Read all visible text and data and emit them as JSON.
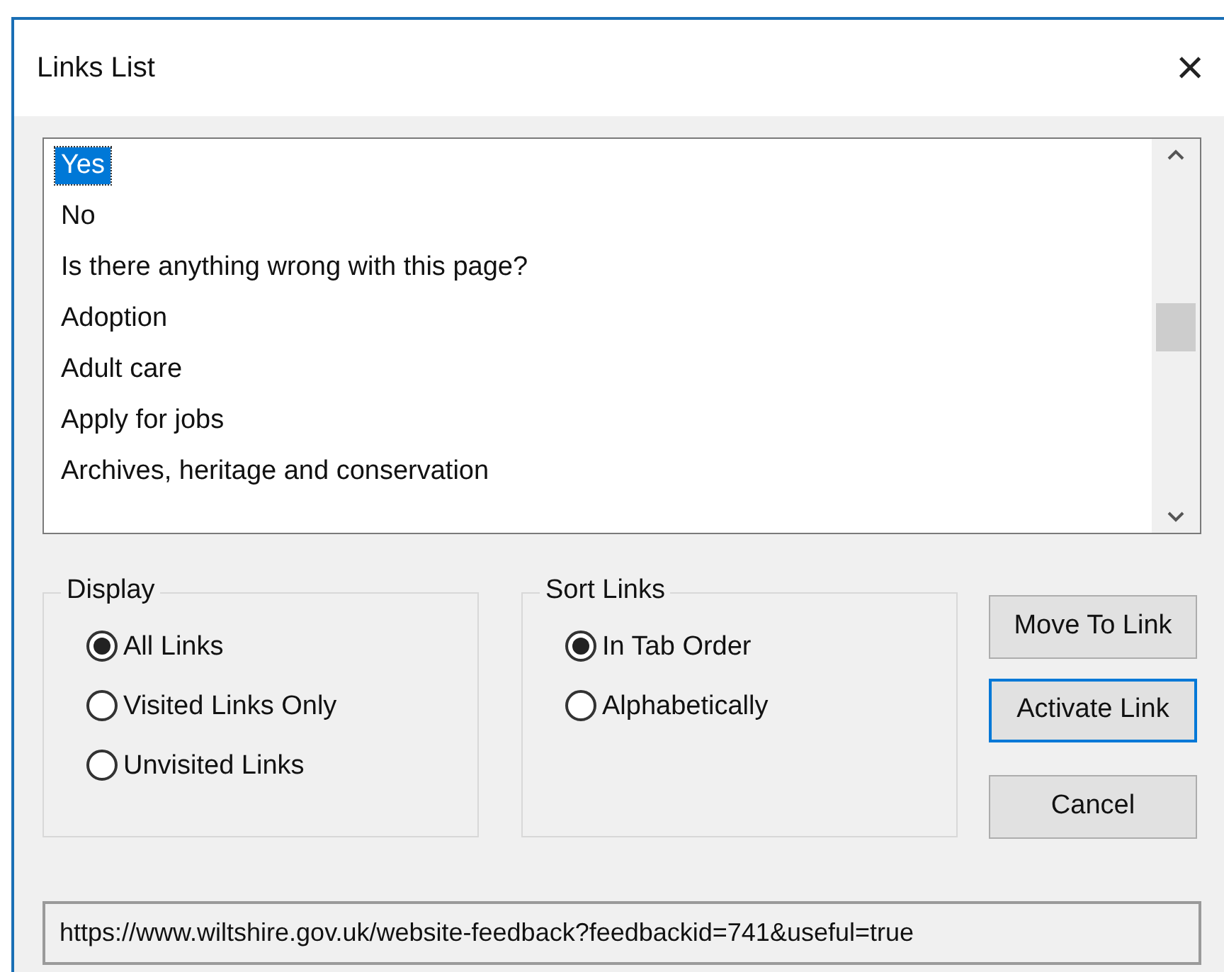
{
  "window": {
    "title": "Links List",
    "close": "×"
  },
  "links": [
    {
      "label": "Yes",
      "selected": true
    },
    {
      "label": "No",
      "selected": false
    },
    {
      "label": "Is there anything wrong with this page?",
      "selected": false
    },
    {
      "label": "Adoption",
      "selected": false
    },
    {
      "label": "Adult care",
      "selected": false
    },
    {
      "label": "Apply for jobs",
      "selected": false
    },
    {
      "label": "Archives, heritage and conservation",
      "selected": false
    }
  ],
  "display": {
    "title": "Display",
    "options": [
      {
        "label": "All Links",
        "selected": true
      },
      {
        "label": "Visited Links Only",
        "selected": false
      },
      {
        "label": "Unvisited Links",
        "selected": false
      }
    ]
  },
  "sort": {
    "title": "Sort Links",
    "options": [
      {
        "label": "In Tab Order",
        "selected": true
      },
      {
        "label": "Alphabetically",
        "selected": false
      }
    ]
  },
  "buttons": [
    {
      "label": "Move To Link",
      "focused": false
    },
    {
      "label": "Activate Link",
      "focused": true
    },
    {
      "label": "Cancel",
      "focused": false
    }
  ],
  "url": "https://www.wiltshire.gov.uk/website-feedback?feedbackid=741&useful=true"
}
